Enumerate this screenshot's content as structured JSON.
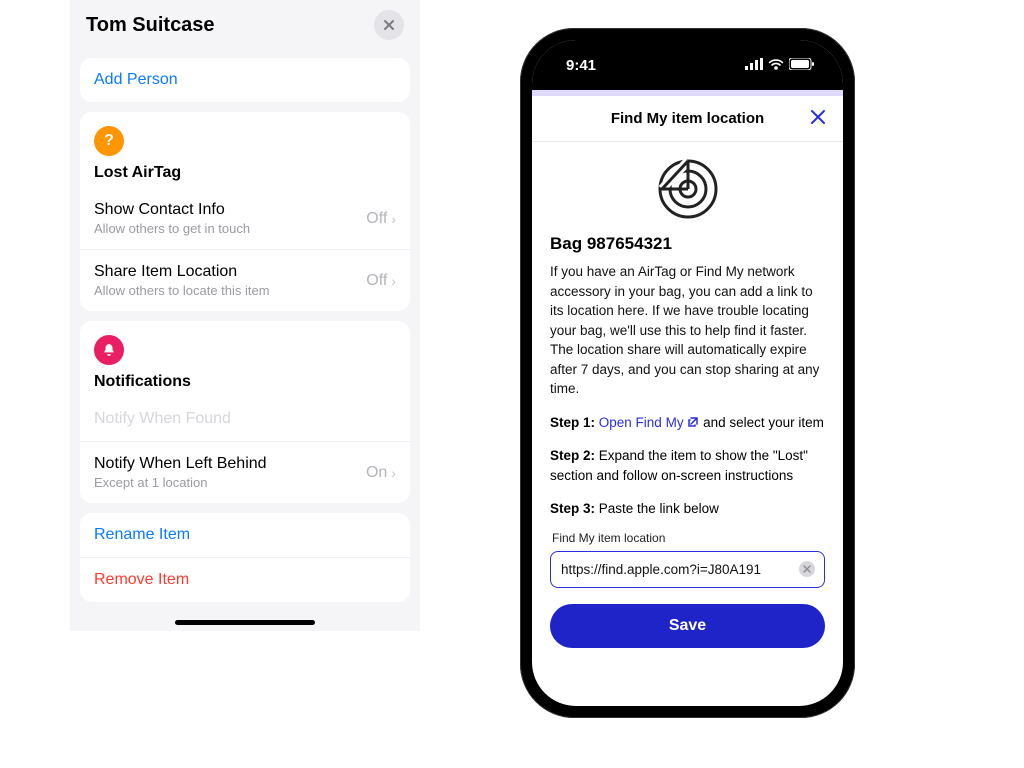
{
  "left": {
    "title": "Tom Suitcase",
    "add_person": "Add Person",
    "lost_section": {
      "title": "Lost AirTag",
      "rows": [
        {
          "title": "Show Contact Info",
          "sub": "Allow others to get in touch",
          "value": "Off"
        },
        {
          "title": "Share Item Location",
          "sub": "Allow others to locate this item",
          "value": "Off"
        }
      ]
    },
    "notif_section": {
      "title": "Notifications",
      "found": "Notify When Found",
      "left_behind": {
        "title": "Notify When Left Behind",
        "sub": "Except at 1 location",
        "value": "On"
      }
    },
    "rename": "Rename Item",
    "remove": "Remove Item"
  },
  "right": {
    "time": "9:41",
    "modal_title": "Find My item location",
    "bag": "Bag 987654321",
    "description": "If you have an AirTag or Find My network accessory in your bag, you can add a link to its location here. If we have trouble locating your bag, we'll use this to help find it faster. The location share will automatically expire after 7 days, and you can stop sharing at any time.",
    "step1_label": "Step 1:",
    "step1_link": "Open Find My",
    "step1_rest": " and select your item",
    "step2_label": "Step 2:",
    "step2_text": " Expand the item to show the \"Lost\" section and follow on-screen instructions",
    "step3_label": "Step 3:",
    "step3_text": " Paste the link below",
    "field_label": "Find My item location",
    "url_value": "https://find.apple.com?i=J80A191",
    "save": "Save"
  }
}
